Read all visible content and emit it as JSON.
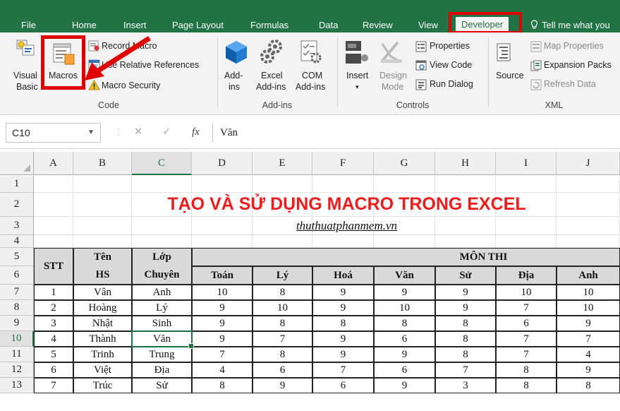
{
  "tabs": [
    {
      "label": "File"
    },
    {
      "label": "Home"
    },
    {
      "label": "Insert"
    },
    {
      "label": "Page Layout"
    },
    {
      "label": "Formulas"
    },
    {
      "label": "Data"
    },
    {
      "label": "Review"
    },
    {
      "label": "View"
    },
    {
      "label": "Developer",
      "active": true
    }
  ],
  "tell_me": "Tell me what you",
  "ribbon": {
    "code": {
      "visual_basic": [
        "Visual",
        "Basic"
      ],
      "macros": "Macros",
      "record_macro": "Record Macro",
      "relative_refs": "Use Relative References",
      "macro_security": "Macro Security",
      "group_label": "Code"
    },
    "addins": {
      "addins": [
        "Add-",
        "ins"
      ],
      "excel_addins": [
        "Excel",
        "Add-ins"
      ],
      "com_addins": [
        "COM",
        "Add-ins"
      ],
      "group_label": "Add-ins"
    },
    "controls": {
      "insert": "Insert",
      "design_mode": [
        "Design",
        "Mode"
      ],
      "properties": "Properties",
      "view_code": "View Code",
      "run_dialog": "Run Dialog",
      "group_label": "Controls"
    },
    "xml": {
      "source": "Source",
      "map_properties": "Map Properties",
      "expansion_packs": "Expansion Packs",
      "refresh_data": "Refresh Data",
      "group_label": "XML"
    }
  },
  "formula_bar": {
    "name_box": "C10",
    "cancel": "✕",
    "enter": "✓",
    "fx": "fx",
    "formula": "Văn"
  },
  "sheet": {
    "columns": [
      "A",
      "B",
      "C",
      "D",
      "E",
      "F",
      "G",
      "H",
      "I",
      "J"
    ],
    "rows": [
      "1",
      "2",
      "3",
      "4",
      "5",
      "6",
      "7",
      "8",
      "9",
      "10",
      "11",
      "12",
      "13"
    ],
    "title": "TẠO VÀ SỬ DỤNG MACRO TRONG EXCEL",
    "subtitle": "thuthuatphanmem.vn",
    "headers": {
      "stt": "STT",
      "ten": "Tên",
      "hs": "HS",
      "lop": "Lớp",
      "chuyen": "Chuyên",
      "mon_thi": "MÔN THI",
      "subjects": [
        "Toán",
        "Lý",
        "Hoá",
        "Văn",
        "Sử",
        "Địa",
        "Anh"
      ]
    },
    "students": [
      {
        "stt": "1",
        "name": "Vân",
        "class": "Anh",
        "scores": [
          "10",
          "8",
          "9",
          "9",
          "9",
          "10",
          "10"
        ]
      },
      {
        "stt": "2",
        "name": "Hoàng",
        "class": "Lý",
        "scores": [
          "9",
          "10",
          "9",
          "10",
          "9",
          "7",
          "10"
        ]
      },
      {
        "stt": "3",
        "name": "Nhật",
        "class": "Sinh",
        "scores": [
          "9",
          "8",
          "8",
          "8",
          "8",
          "6",
          "9"
        ]
      },
      {
        "stt": "4",
        "name": "Thành",
        "class": "Văn",
        "scores": [
          "9",
          "7",
          "9",
          "6",
          "8",
          "7",
          "7"
        ]
      },
      {
        "stt": "5",
        "name": "Trinh",
        "class": "Trung",
        "scores": [
          "7",
          "8",
          "9",
          "9",
          "8",
          "7",
          "4"
        ]
      },
      {
        "stt": "6",
        "name": "Việt",
        "class": "Địa",
        "scores": [
          "4",
          "6",
          "7",
          "6",
          "7",
          "8",
          "9"
        ]
      },
      {
        "stt": "7",
        "name": "Trúc",
        "class": "Sử",
        "scores": [
          "8",
          "9",
          "6",
          "9",
          "3",
          "8",
          "8"
        ]
      }
    ]
  },
  "colors": {
    "ribbon_green": "#217346",
    "highlight_red": "#e00000",
    "title_red": "#ee1c1c",
    "header_gray": "#d9d9d9"
  }
}
